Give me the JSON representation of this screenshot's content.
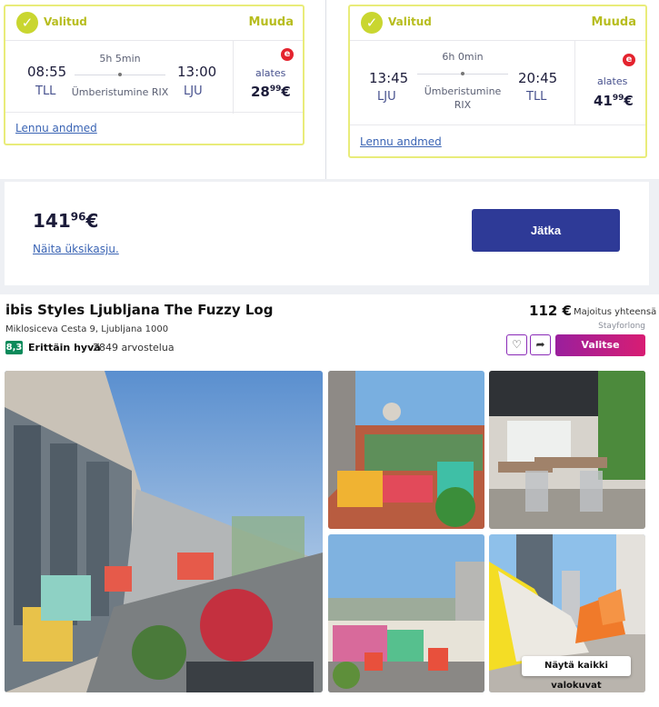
{
  "flights": [
    {
      "status": "Valitud",
      "change": "Muuda",
      "depart_time": "08:55",
      "depart_code": "TLL",
      "duration": "5h 5min",
      "stop": "Ümberistumine RIX",
      "arrive_time": "13:00",
      "arrive_code": "LJU",
      "airline_logo": "e",
      "from_label": "alates",
      "price_main": "28",
      "price_cents": "99",
      "currency": "€",
      "details_link": "Lennu andmed"
    },
    {
      "status": "Valitud",
      "change": "Muuda",
      "depart_time": "13:45",
      "depart_code": "LJU",
      "duration": "6h 0min",
      "stop": "Ümberistumine RIX",
      "arrive_time": "20:45",
      "arrive_code": "TLL",
      "airline_logo": "e",
      "from_label": "alates",
      "price_main": "41",
      "price_cents": "99",
      "currency": "€",
      "details_link": "Lennu andmed"
    }
  ],
  "total": {
    "price_main": "141",
    "price_cents": "96",
    "currency": "€",
    "breakdown_link": "Näita üksikasju.",
    "continue_label": "Jätka"
  },
  "hotel": {
    "name": "ibis Styles Ljubljana The Fuzzy Log",
    "address": "Miklosiceva Cesta 9, Ljubljana 1000",
    "score": "8,3",
    "rating_text": "Erittäin hyvä",
    "reviews": "2849 arvostelua",
    "price": "112 €",
    "price_note": "Majoitus yhteensä",
    "provider": "Stayforlong",
    "favorite_icon": "heart-icon",
    "share_icon": "share-icon",
    "select_label": "Valitse",
    "all_photos_label": "Näytä kaikki valokuvat"
  },
  "colors": {
    "selected_accent": "#c9d630",
    "primary_button": "#2e3a97",
    "select_button": "#c01d83",
    "score_badge": "#0b8a5a"
  }
}
